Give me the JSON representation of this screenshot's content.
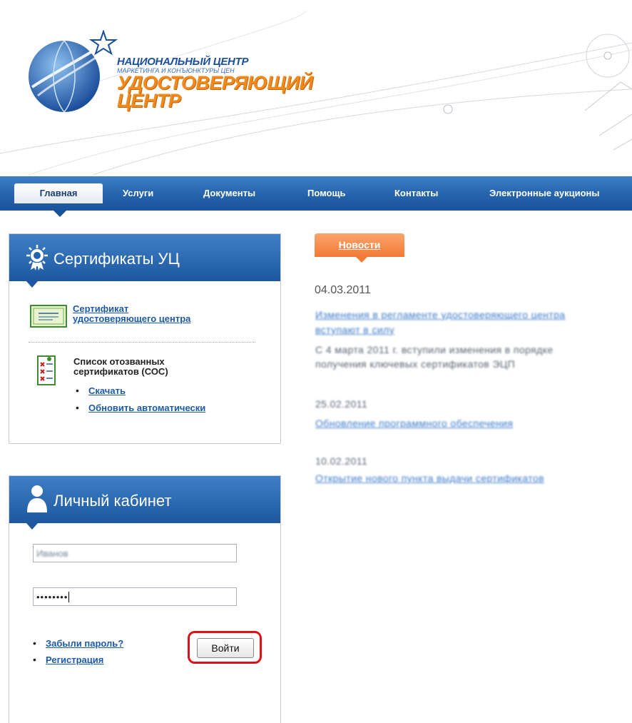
{
  "logo": {
    "line1": "НАЦИОНАЛЬНЫЙ ЦЕНТР",
    "line2": "МАРКЕТИНГА И КОНЪЮНКТУРЫ ЦЕН",
    "line3": "УДОСТОВЕРЯЮЩИЙ",
    "line4": "ЦЕНТР"
  },
  "nav": {
    "items": [
      "Главная",
      "Услуги",
      "Документы",
      "Помощь",
      "Контакты",
      "Электронные аукционы"
    ],
    "active": "Главная"
  },
  "certs_panel": {
    "title": "Сертификаты УЦ",
    "cert_link_line1": "Сертификат",
    "cert_link_line2": "удостоверяющего центра",
    "crl_title_line1": "Список отозванных",
    "crl_title_line2": "сертификатов (СОС)",
    "download": "Скачать",
    "auto_update": "Обновить автоматически"
  },
  "login_panel": {
    "title": "Личный кабинет",
    "username_value": "Иванов",
    "password_value": "••••••••",
    "forgot": "Забыли пароль?",
    "register": "Регистрация",
    "login_button": "Войти"
  },
  "news": {
    "tab": "Новости",
    "date": "04.03.2011",
    "item1_link": "Изменения в регламенте удостоверяющего центра",
    "item1_link2": "вступают в силу",
    "item1_text": "С 4 марта 2011 г. вступили изменения в порядке",
    "item1_text2": "получения ключевых сертификатов ЭЦП",
    "item2_date": "25.02.2011",
    "item2_link": "Обновление программного обеспечения",
    "item3_date": "10.02.2011",
    "item3_link": "Открытие нового пункта выдачи сертификатов"
  },
  "colors": {
    "nav_blue": "#2463ad",
    "accent_orange": "#f27a36",
    "link_blue": "#1c5aa8",
    "highlight_red": "#e01018"
  }
}
